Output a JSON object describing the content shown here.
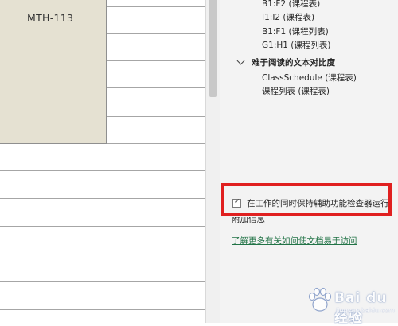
{
  "sheet": {
    "merged_cell_text": "MTH-113"
  },
  "pane": {
    "items_top": [
      "B1:F2 (课程表)",
      "I1:I2 (课程表)",
      "B1:F1 (课程列表)",
      "G1:H1 (课程列表)"
    ],
    "section": {
      "title": "难于阅读的文本对比度",
      "items": [
        "ClassSchedule (课程表)",
        "课程列表 (课程表)"
      ]
    },
    "checkbox": {
      "label": "在工作的同时保持辅助功能检查器运行",
      "checked": true,
      "mark": "✓"
    },
    "additional_info_label": "附加信息",
    "help_link": "了解更多有关如何使文档易于访问"
  },
  "watermark": {
    "text": "Bai du 经验",
    "sub": "jingyan.baidu.com"
  },
  "colors": {
    "merged_cell_bg": "#e5e1d2",
    "pane_bg": "#f3f3f3",
    "highlight": "#e02020",
    "link": "#217346"
  }
}
